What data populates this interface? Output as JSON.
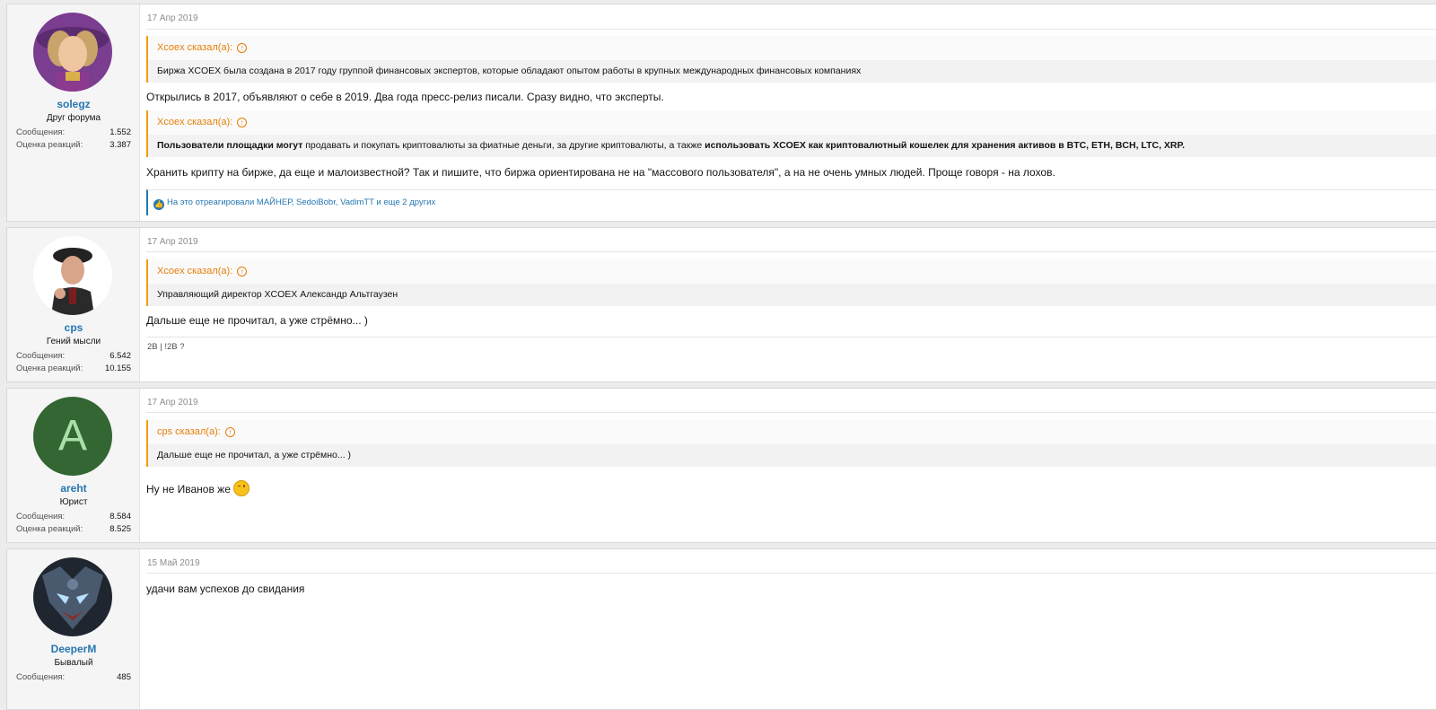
{
  "posts": [
    {
      "user": {
        "name": "solegz",
        "title": "Друг форума",
        "messages_label": "Сообщения:",
        "messages": "1.552",
        "reactions_label": "Оценка реакций:",
        "reactions": "3.387",
        "avatar_icon": "user-avatar-photo"
      },
      "date": "17 Апр 2019",
      "quote1": {
        "author": "Xcoex сказал(а):",
        "text": "Биржа XCOEX была создана в 2017 году группой финансовых экспертов, которые обладают опытом работы в крупных международных финансовых компаниях"
      },
      "text1": "Открылись в 2017, объявляют о себе в 2019. Два года пресс-релиз писали. Сразу видно, что эксперты.",
      "quote2": {
        "author": "Xcoex сказал(а):",
        "bold1": "Пользователи площадки могут",
        "plain1": " продавать и покупать криптовалюты за фиатные деньги, за другие криптовалюты, а также ",
        "bold2": "использовать XCOEX как криптовалютный кошелек для хранения активов в BTC, ETH, BCH, LTC, XRP."
      },
      "text2": "Хранить крипту на бирже, да еще и малоизвестной? Так и пишите, что биржа ориентирована не на \"массового пользователя\", а на не очень умных людей. Проще говоря - на лохов.",
      "reactions_text": "На это отреагировали МАЙНЕР, SedoiBobr, VadimTT и еще 2 других"
    },
    {
      "user": {
        "name": "cps",
        "title": "Гений мысли",
        "messages_label": "Сообщения:",
        "messages": "6.542",
        "reactions_label": "Оценка реакций:",
        "reactions": "10.155",
        "avatar_icon": "user-avatar-photo"
      },
      "date": "17 Апр 2019",
      "quote1": {
        "author": "Xcoex сказал(а):",
        "text": "Управляющий директор XCOEX Александр Альтгаузен"
      },
      "text1": "Дальше еще не прочитал, а уже стрёмно... )",
      "signature": "2B | !2B ?"
    },
    {
      "user": {
        "name": "areht",
        "title": "Юрист",
        "messages_label": "Сообщения:",
        "messages": "8.584",
        "reactions_label": "Оценка реакций:",
        "reactions": "8.525",
        "avatar_letter": "A",
        "avatar_color": "#336633"
      },
      "date": "17 Апр 2019",
      "quote1": {
        "author": "cps сказал(а):",
        "text": "Дальше еще не прочитал, а уже стрёмно... )"
      },
      "text1": "Ну не Иванов же",
      "emoji": "wink-emoji"
    },
    {
      "user": {
        "name": "DeeperM",
        "title": "Бывалый",
        "messages_label": "Сообщения:",
        "messages": "485",
        "avatar_icon": "user-avatar-photo"
      },
      "date": "15 Май 2019",
      "text1": "удачи вам успехов до свидания"
    }
  ],
  "icons": {
    "quote_jump": "arrow-up-circle-icon",
    "like": "thumbs-up-icon"
  },
  "colors": {
    "username": "#2577b1",
    "quote_accent": "#f39c12",
    "background": "#ececec"
  }
}
